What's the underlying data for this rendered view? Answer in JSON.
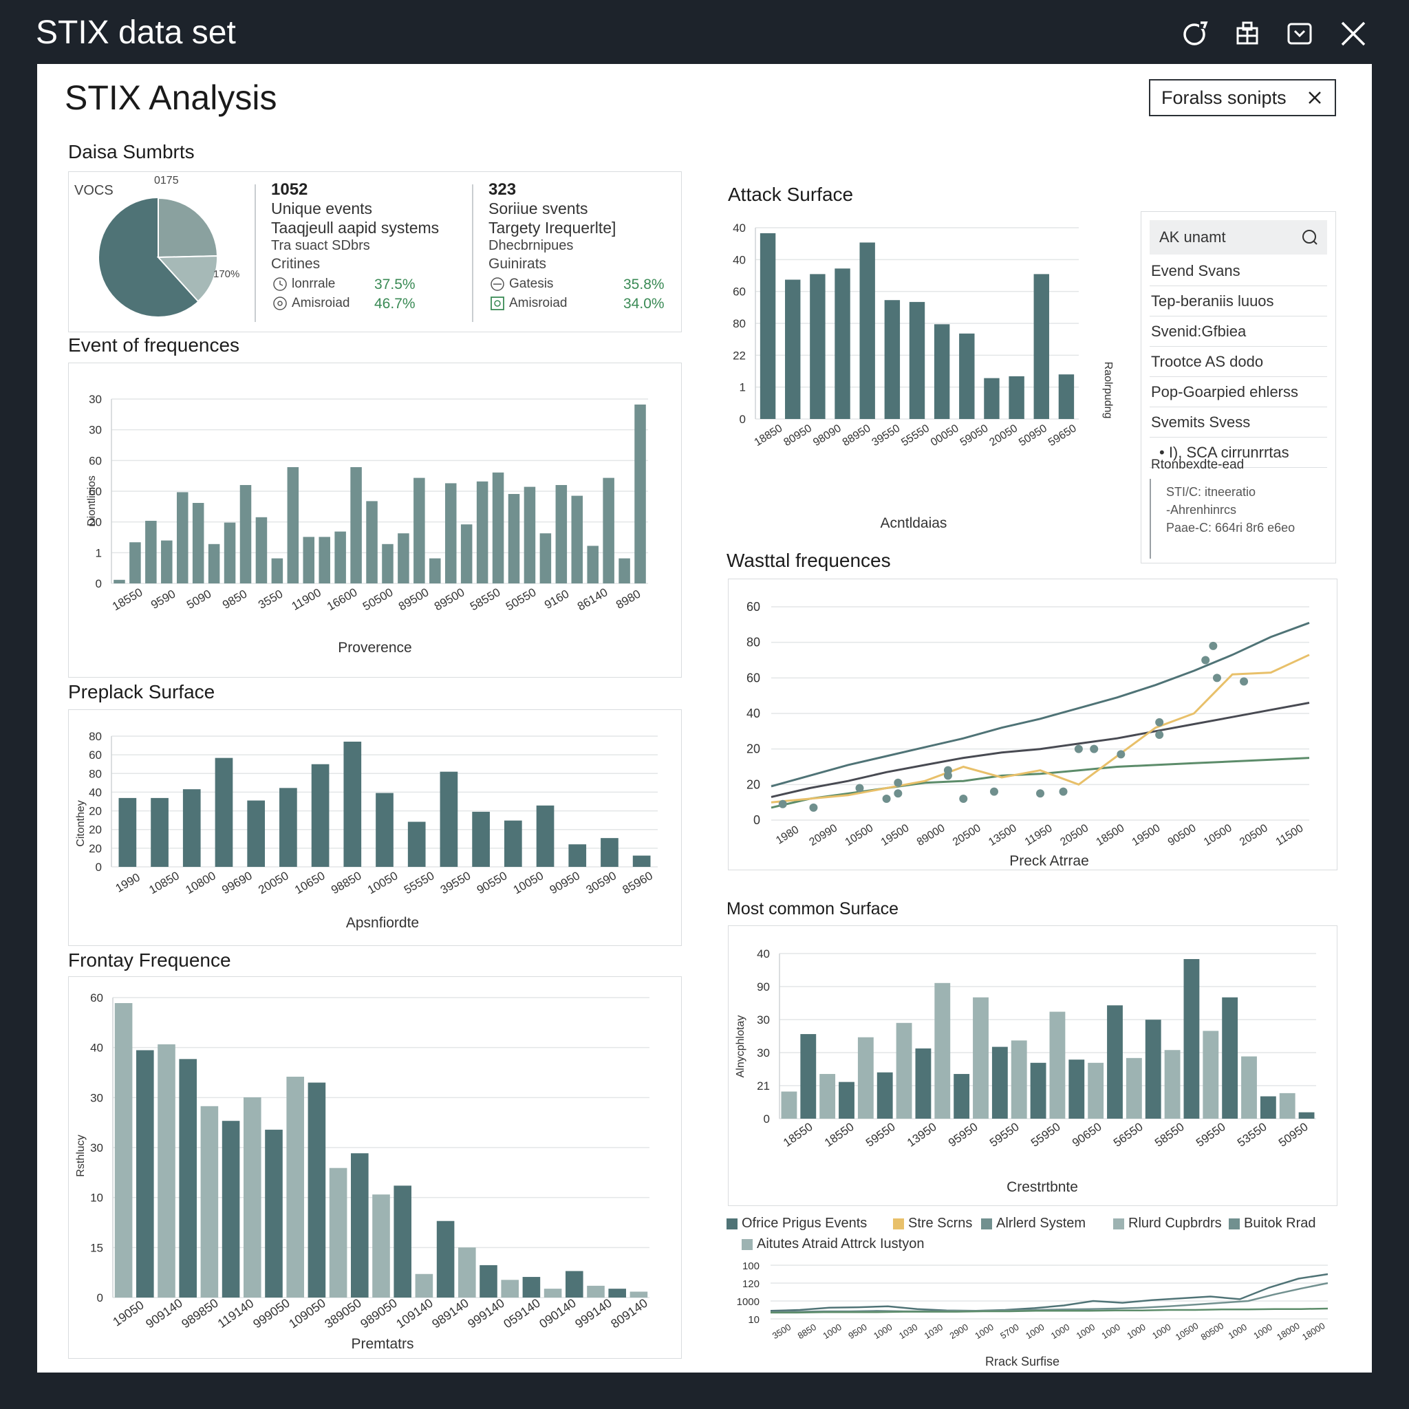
{
  "window": {
    "title": "STIX data set"
  },
  "page": {
    "title": "STIX Analysis"
  },
  "filter": {
    "label": "Foralss sonipts"
  },
  "colors": {
    "dark": "#4f7376",
    "mid": "#71908f",
    "light": "#9db3b2",
    "gold": "#e8c06a",
    "green": "#5c8c6a",
    "ink": "#484a52",
    "positive": "#3a8a55"
  },
  "summary": {
    "title": "Daisa Sumbrts",
    "pie_label": "VOCS",
    "pie_top": "0175",
    "pie_right": "170%",
    "block1": {
      "num": "1052",
      "line1": "Unique events",
      "line2": "Taaqjeull aapid systems",
      "line3": "Tra suact SDbrs",
      "line4": "Critines",
      "item1": "lonrrale",
      "pct1": "37.5%",
      "item2": "Amisroiad",
      "pct2": "46.7%"
    },
    "block2": {
      "num": "323",
      "line1": "Soriiue svents",
      "line2": "Targety Irequerlte]",
      "line3": "Dhecbrnipues",
      "line4": "Guinirats",
      "item1": "Gatesis",
      "pct1": "35.8%",
      "item2": "Amisroiad",
      "pct2": "34.0%"
    }
  },
  "sidebar": {
    "search_placeholder": "AK unamt",
    "items": [
      "Evend Svans",
      "Tep-beraniis luuos",
      "Svenid:Gfbiea",
      "Trootce AS dodo",
      "Pop-Goarpied ehlerss",
      "Svemits Svess",
      "• I), SCA cirrunrrtas",
      "Rtonbexdte-ead"
    ],
    "note": [
      "STI/C: itneeratio",
      "-Ahrenhinrcs",
      "Paae-C: 664ri 8r6 e6eo"
    ]
  },
  "legend_items": [
    "Ofrice Prigus Events",
    "Stre Scrns",
    "Alrlerd System",
    "Rlurd Cupbrdrs",
    "Buitok Rrad",
    "Aitutes Atraid Attrck Iustyon"
  ],
  "chart_data": [
    {
      "id": "event-frequences",
      "type": "bar",
      "title": "Event of frequences",
      "xlabel": "Proverence",
      "ylabel": "Diontlinios",
      "ytick_labels": [
        "0",
        "1",
        "20",
        "60",
        "60",
        "30",
        "30"
      ],
      "xtick_labels": [
        "18550",
        "9590",
        "5090",
        "9850",
        "3550",
        "11900",
        "16600",
        "50500",
        "89500",
        "89500",
        "58550",
        "50550",
        "9160",
        "86140",
        "8980"
      ],
      "values": [
        2,
        23,
        35,
        24,
        51,
        45,
        22,
        34,
        55,
        37,
        14,
        65,
        26,
        26,
        29,
        65,
        46,
        22,
        28,
        59,
        14,
        56,
        33,
        57,
        62,
        50,
        54,
        28,
        55,
        49,
        21,
        59,
        14,
        100
      ]
    },
    {
      "id": "attack-surface",
      "type": "bar",
      "title": "Attack Surface",
      "xlabel": "Acntldaias",
      "ylabel": "Raolrpudng",
      "ytick_labels": [
        "0",
        "1",
        "22",
        "80",
        "60",
        "40",
        "40"
      ],
      "xtick_labels": [
        "18850",
        "80950",
        "98090",
        "88950",
        "39550",
        "55550",
        "00050",
        "59050",
        "20050",
        "50950",
        "59650"
      ],
      "values": [
        100,
        75,
        78,
        81,
        95,
        64,
        63,
        51,
        46,
        22,
        23,
        78,
        24
      ]
    },
    {
      "id": "preplack-surface",
      "type": "bar",
      "title": "Preplack Surface",
      "xlabel": "Apsnfiordte",
      "ylabel": "Citonthey",
      "ytick_labels": [
        "0",
        "20",
        "20",
        "20",
        "40",
        "80",
        "60",
        "80"
      ],
      "xtick_labels": [
        "1990",
        "10850",
        "10800",
        "99690",
        "20050",
        "10650",
        "98850",
        "10050",
        "55550",
        "39550",
        "90550",
        "10050",
        "90950",
        "30590",
        "85960"
      ],
      "values": [
        55,
        55,
        62,
        87,
        53,
        63,
        82,
        100,
        59,
        36,
        76,
        44,
        37,
        49,
        18,
        23,
        9
      ]
    },
    {
      "id": "frontay-frequence",
      "type": "bar",
      "title": "Frontay Frequence",
      "xlabel": "Premtatrs",
      "ylabel": "Rsthlucy",
      "ytick_labels": [
        "0",
        "15",
        "10",
        "30",
        "30",
        "40",
        "60"
      ],
      "xtick_labels": [
        "19050",
        "909140",
        "989850",
        "119140",
        "999050",
        "109050",
        "389050",
        "989050",
        "109140",
        "989140",
        "999140",
        "059140",
        "090140",
        "999140",
        "809140"
      ],
      "values": [
        100,
        84,
        86,
        81,
        65,
        60,
        68,
        57,
        75,
        73,
        44,
        49,
        35,
        38,
        8,
        26,
        17,
        11,
        6,
        7,
        3,
        9,
        4,
        3,
        2
      ]
    },
    {
      "id": "wasttal-frequences",
      "type": "line",
      "title": "Wasttal frequences",
      "xlabel": "Preck Atrrae",
      "ytick_labels": [
        "0",
        "20",
        "20",
        "40",
        "60",
        "80",
        "60"
      ],
      "xtick_labels": [
        "1980",
        "20990",
        "10500",
        "19500",
        "89000",
        "20500",
        "13500",
        "11950",
        "20500",
        "18500",
        "19500",
        "90500",
        "10500",
        "20500",
        "11500"
      ],
      "series": [
        {
          "values": [
            19,
            25,
            31,
            36,
            41,
            46,
            52,
            57,
            63,
            69,
            76,
            84,
            93,
            103,
            111
          ]
        },
        {
          "values": [
            13,
            18,
            22,
            27,
            31,
            35,
            38,
            40,
            43,
            46,
            50,
            54,
            58,
            62,
            66
          ]
        },
        {
          "values": [
            7,
            12,
            15,
            18,
            21,
            22,
            25,
            26,
            28,
            30,
            31,
            32,
            33,
            34,
            35
          ]
        },
        {
          "values": [
            10,
            12,
            14,
            18,
            22,
            30,
            24,
            28,
            20,
            36,
            52,
            60,
            82,
            83,
            93
          ]
        }
      ],
      "points": [
        [
          0.3,
          9
        ],
        [
          1.1,
          7
        ],
        [
          2.3,
          18
        ],
        [
          3.0,
          12
        ],
        [
          3.3,
          21
        ],
        [
          4.6,
          25
        ],
        [
          4.6,
          28
        ],
        [
          3.3,
          15
        ],
        [
          5.0,
          12
        ],
        [
          5.8,
          16
        ],
        [
          7.0,
          15
        ],
        [
          7.6,
          16
        ],
        [
          8.0,
          40
        ],
        [
          8.4,
          40
        ],
        [
          9.1,
          37
        ],
        [
          10.1,
          48
        ],
        [
          10.1,
          55
        ],
        [
          11.3,
          90
        ],
        [
          11.5,
          98
        ],
        [
          11.6,
          80
        ],
        [
          12.3,
          78
        ]
      ]
    },
    {
      "id": "most-common-surface",
      "type": "bar",
      "title": "Most common Surface",
      "xlabel": "Crestrtbnte",
      "ylabel": "Alnycphlotay",
      "ytick_labels": [
        "0",
        "21",
        "30",
        "30",
        "90",
        "40"
      ],
      "xtick_labels": [
        "18550",
        "18550",
        "59550",
        "13950",
        "95950",
        "59550",
        "55950",
        "90650",
        "56550",
        "58550",
        "59550",
        "53550",
        "50950"
      ],
      "values": [
        17,
        53,
        28,
        23,
        51,
        29,
        60,
        44,
        85,
        28,
        76,
        45,
        49,
        35,
        67,
        37,
        35,
        71,
        38,
        62,
        43,
        100,
        55,
        76,
        39,
        14,
        16,
        4
      ]
    },
    {
      "id": "mini-line",
      "type": "line",
      "xlabel": "Rrack Surfise",
      "ytick_labels": [
        "10",
        "1000",
        "120",
        "100"
      ],
      "xtick_labels": [
        "3500",
        "8850",
        "1000",
        "9500",
        "1000",
        "1030",
        "1030",
        "2900",
        "1000",
        "5700",
        "1000",
        "1000",
        "1000",
        "1000",
        "1000",
        "1000",
        "10500",
        "80500",
        "1000",
        "1000",
        "18000",
        "18000"
      ],
      "series": [
        {
          "values": [
            18,
            20,
            25,
            26,
            28,
            22,
            19,
            18,
            20,
            24,
            30,
            40,
            36,
            42,
            46,
            50,
            44,
            70,
            90,
            100
          ]
        },
        {
          "values": [
            15,
            16,
            17,
            17,
            18,
            17,
            17,
            18,
            18,
            19,
            20,
            21,
            22,
            23,
            25,
            28,
            32,
            36,
            40,
            55,
            68,
            80
          ]
        },
        {
          "values": [
            14,
            14,
            15,
            15,
            15,
            16,
            16,
            16,
            17,
            17,
            18,
            18,
            18,
            19,
            19,
            20,
            20,
            21,
            21,
            22,
            22,
            23
          ]
        }
      ]
    }
  ]
}
